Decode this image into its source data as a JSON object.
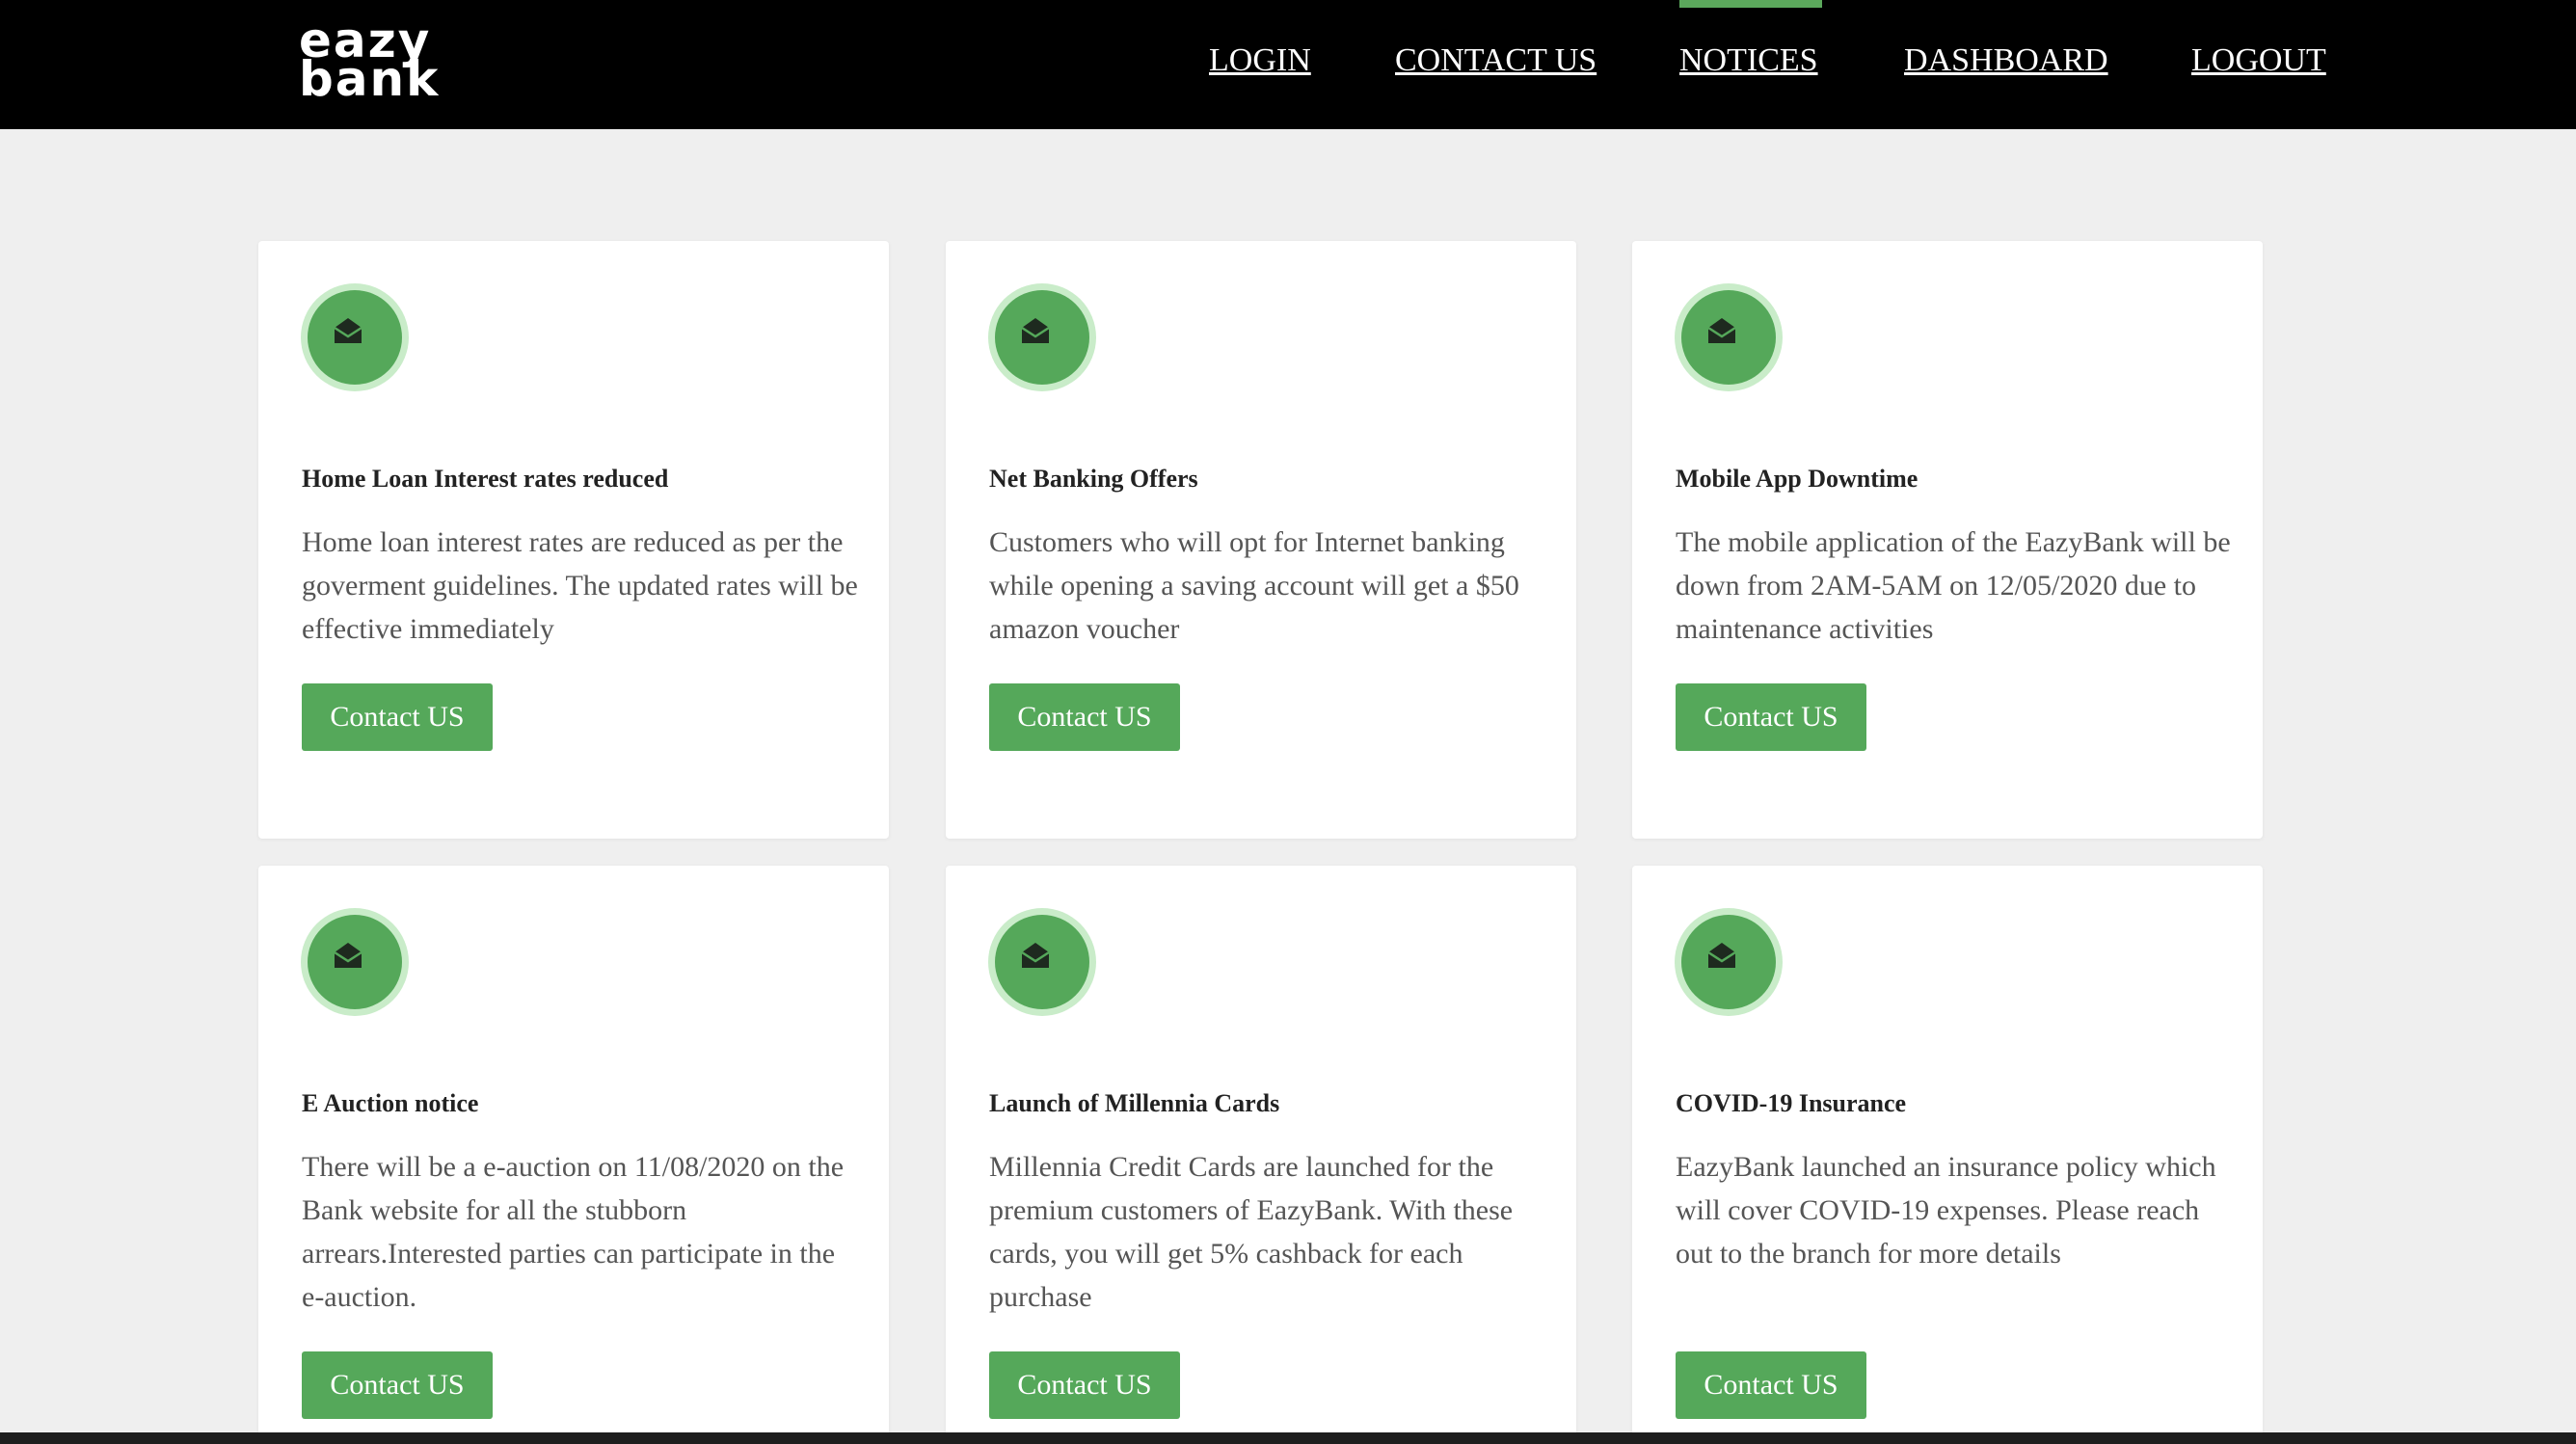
{
  "header": {
    "logo": "eazy\nbank",
    "nav": [
      "LOGIN",
      "CONTACT US",
      "NOTICES",
      "DASHBOARD",
      "LOGOUT"
    ],
    "active_nav": "NOTICES"
  },
  "notices": [
    {
      "title": "Home Loan Interest rates reduced",
      "text": "Home loan interest rates are reduced as per the goverment guidelines. The updated rates will be effective immediately",
      "button": "Contact US"
    },
    {
      "title": "Net Banking Offers",
      "text": "Customers who will opt for Internet banking while opening a saving account will get a $50 amazon voucher",
      "button": "Contact US"
    },
    {
      "title": "Mobile App Downtime",
      "text": "The mobile application of the EazyBank will be down from 2AM-5AM on 12/05/2020 due to maintenance activities",
      "button": "Contact US"
    },
    {
      "title": "E Auction notice",
      "text": "There will be a e-auction on 11/08/2020 on the Bank website for all the stubborn arrears.Interested parties can participate in the e-auction.",
      "button": "Contact US"
    },
    {
      "title": "Launch of Millennia Cards",
      "text": "Millennia Credit Cards are launched for the premium customers of EazyBank. With these cards, you will get 5% cashback for each purchase",
      "button": "Contact US"
    },
    {
      "title": "COVID-19 Insurance",
      "text": "EazyBank launched an insurance policy which will cover COVID-19 expenses. Please reach out to the branch for more details",
      "button": "Contact US"
    }
  ],
  "icons": {
    "notice": "envelope-open-icon"
  },
  "colors": {
    "header_bg": "#000000",
    "accent": "#55a85a",
    "page_bg": "#efefef"
  }
}
